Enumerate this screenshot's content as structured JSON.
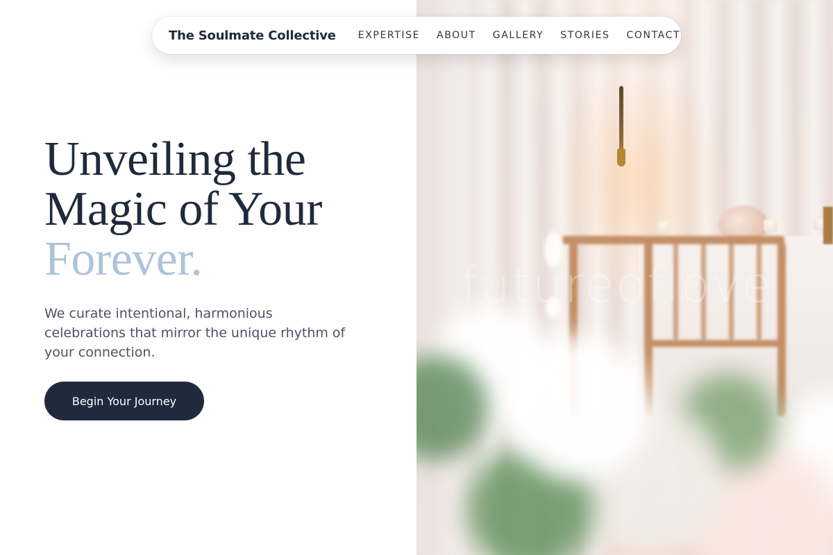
{
  "nav": {
    "brand": "The Soulmate Collective",
    "links": [
      "EXPERTISE",
      "ABOUT",
      "GALLERY",
      "STORIES",
      "CONTACT"
    ]
  },
  "hero": {
    "headline_line1": "Unveiling the",
    "headline_line2": "Magic of Your",
    "headline_accent": "Forever.",
    "subtext": "We curate intentional, harmonious celebrations that mirror the unique rhythm of your connection.",
    "cta_label": "Begin Your Journey"
  },
  "image": {
    "watermark": "futureoflove",
    "description_icon": "wedding-reception-photo"
  },
  "colors": {
    "primary_dark": "#1f2a3e",
    "accent_blue": "#adc3db",
    "text_muted": "#4a5263"
  }
}
